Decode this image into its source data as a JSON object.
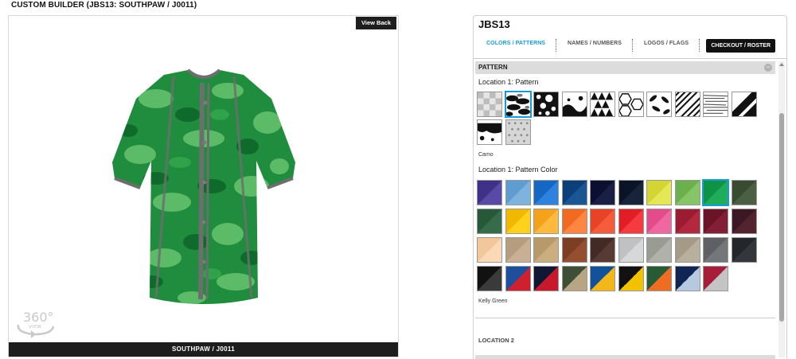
{
  "header": {
    "title": "CUSTOM BUILDER (JBS13: SOUTHPAW / J0011)"
  },
  "preview": {
    "view_back_label": "View Back",
    "footer_label": "SOUTHPAW / J0011",
    "badge_360_label": "360°",
    "badge_view_label": "view"
  },
  "panel": {
    "title": "JBS13",
    "tabs": [
      {
        "label": "COLORS / PATTERNS",
        "active": true
      },
      {
        "label": "NAMES / NUMBERS",
        "active": false
      },
      {
        "label": "LOGOS / FLAGS",
        "active": false
      }
    ],
    "checkout_label": "CHECKOUT / ROSTER",
    "section_title": "PATTERN",
    "collapse_symbol": "−",
    "location1_pattern_label": "Location 1: Pattern",
    "patterns": [
      {
        "name": "transparent-check"
      },
      {
        "name": "camo",
        "selected": true
      },
      {
        "name": "splatter"
      },
      {
        "name": "distressed"
      },
      {
        "name": "triangles"
      },
      {
        "name": "hexagons"
      },
      {
        "name": "leaves"
      },
      {
        "name": "diagonal-lines"
      },
      {
        "name": "brush-lines"
      },
      {
        "name": "slash"
      },
      {
        "name": "grunge"
      },
      {
        "name": "gradient-dots"
      }
    ],
    "selected_pattern_name": "Camo",
    "location1_color_label": "Location 1: Pattern Color",
    "colors": [
      {
        "name": "Purple",
        "c1": "#3e3187",
        "c2": "#5a4aa8"
      },
      {
        "name": "Columbia Blue",
        "c1": "#5f9ccf",
        "c2": "#7db3dd"
      },
      {
        "name": "Royal",
        "c1": "#1666c3",
        "c2": "#2c82dd"
      },
      {
        "name": "Dark Royal",
        "c1": "#0c3f79",
        "c2": "#1a5594"
      },
      {
        "name": "Navy",
        "c1": "#0b1030",
        "c2": "#1a1f45"
      },
      {
        "name": "Dark Navy",
        "c1": "#0a1426",
        "c2": "#17223b"
      },
      {
        "name": "Optic Yellow",
        "c1": "#d4d532",
        "c2": "#e6e754"
      },
      {
        "name": "Lime",
        "c1": "#6ab04c",
        "c2": "#85c565"
      },
      {
        "name": "Kelly Green",
        "c1": "#0f9447",
        "c2": "#1fad5c",
        "selected": true
      },
      {
        "name": "Forest",
        "c1": "#394c32",
        "c2": "#4b6043"
      },
      {
        "name": "Dark Green",
        "c1": "#28583a",
        "c2": "#356c49"
      },
      {
        "name": "Gold",
        "c1": "#f1b800",
        "c2": "#ffd01c"
      },
      {
        "name": "Athletic Gold",
        "c1": "#f5a21b",
        "c2": "#ffba3d"
      },
      {
        "name": "Orange",
        "c1": "#f26a21",
        "c2": "#ff8540"
      },
      {
        "name": "Red Orange",
        "c1": "#e84324",
        "c2": "#f55c3c"
      },
      {
        "name": "Red",
        "c1": "#e31d25",
        "c2": "#f53a40"
      },
      {
        "name": "Pink",
        "c1": "#e34b8a",
        "c2": "#f066a0"
      },
      {
        "name": "Cardinal",
        "c1": "#9b1c30",
        "c2": "#b2283f"
      },
      {
        "name": "Maroon",
        "c1": "#6b1428",
        "c2": "#821f36"
      },
      {
        "name": "Dark Maroon",
        "c1": "#3c1824",
        "c2": "#512430"
      },
      {
        "name": "Peach",
        "c1": "#f3c79c",
        "c2": "#fbd9b6"
      },
      {
        "name": "Sand",
        "c1": "#b79d80",
        "c2": "#c9b094"
      },
      {
        "name": "Vegas Gold",
        "c1": "#b89a6a",
        "c2": "#cbae80"
      },
      {
        "name": "Brown",
        "c1": "#7d3f23",
        "c2": "#954f30"
      },
      {
        "name": "Dark Brown",
        "c1": "#432b25",
        "c2": "#563a33"
      },
      {
        "name": "Silver",
        "c1": "#bfc1c3",
        "c2": "#d6d8da"
      },
      {
        "name": "Sage",
        "c1": "#9a9b93",
        "c2": "#b0b1a9"
      },
      {
        "name": "Khaki",
        "c1": "#a49a86",
        "c2": "#b8af9c"
      },
      {
        "name": "Grey",
        "c1": "#5e6063",
        "c2": "#74777a"
      },
      {
        "name": "Charcoal",
        "c1": "#23262a",
        "c2": "#33373c"
      },
      {
        "name": "Black / Charcoal",
        "c1": "#111111",
        "c2": "#3a3a3a"
      },
      {
        "name": "Royal / Red",
        "c1": "#1f4f9b",
        "c2": "#d02030"
      },
      {
        "name": "Navy / Red",
        "c1": "#101734",
        "c2": "#c7192b"
      },
      {
        "name": "Forest / Sand",
        "c1": "#3e4f35",
        "c2": "#b7a584"
      },
      {
        "name": "Royal / Gold",
        "c1": "#11529a",
        "c2": "#f3b719"
      },
      {
        "name": "Black / Gold",
        "c1": "#111111",
        "c2": "#f2c200"
      },
      {
        "name": "Green / Orange",
        "c1": "#285b34",
        "c2": "#ef6c23"
      },
      {
        "name": "Navy / Columbia",
        "c1": "#102553",
        "c2": "#b7c9e0"
      },
      {
        "name": "Cardinal / Silver",
        "c1": "#a61e38",
        "c2": "#c4c4c4"
      }
    ],
    "selected_color_name": "Kelly Green",
    "location2_label": "LOCATION 2"
  }
}
